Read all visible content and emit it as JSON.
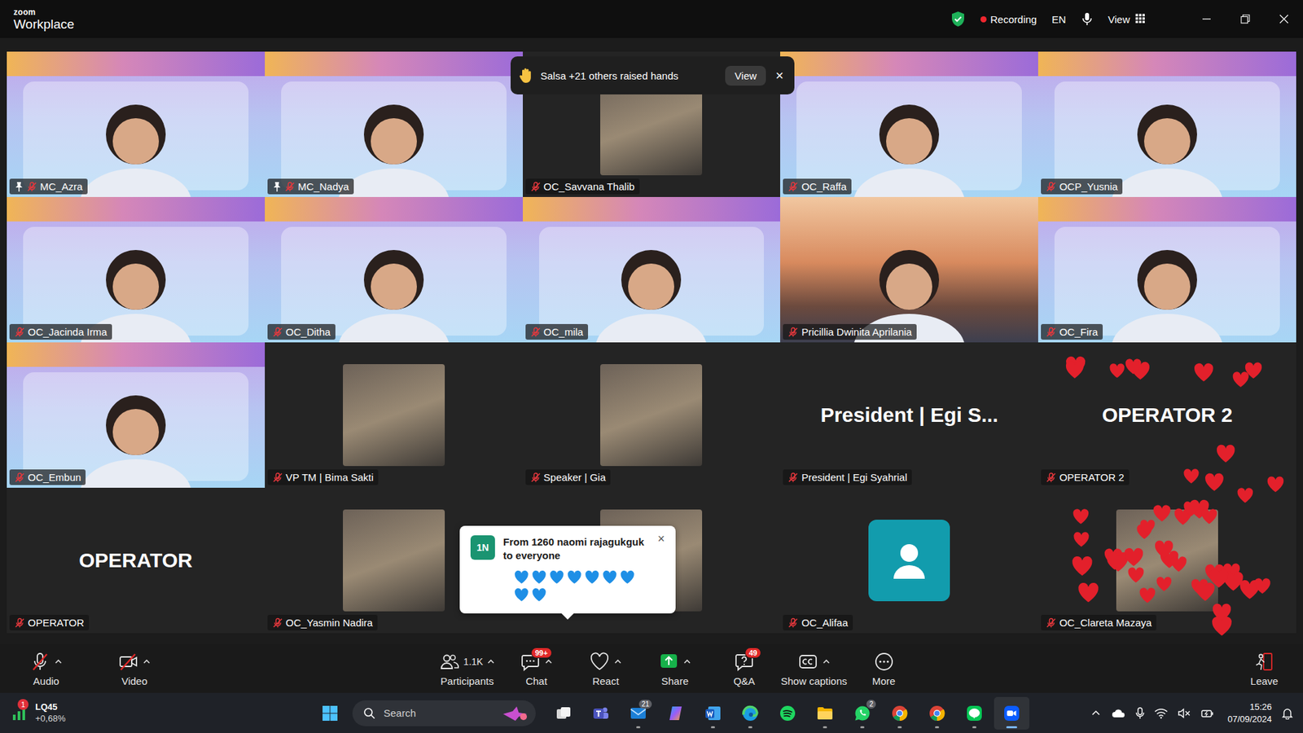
{
  "window": {
    "brand": "zoom",
    "product": "Workplace"
  },
  "status": {
    "secure": true,
    "recording": "Recording",
    "language": "EN",
    "view": "View"
  },
  "raised_hands": {
    "text": "Salsa +21 others raised hands",
    "action": "View",
    "close": "×"
  },
  "tiles": [
    {
      "name": "MC_Azra",
      "kind": "branded",
      "muted": true,
      "pinned": true,
      "speaking": true
    },
    {
      "name": "MC_Nadya",
      "kind": "branded",
      "muted": true,
      "pinned": true,
      "speaking": false
    },
    {
      "name": "OC_Savvana Thalib",
      "kind": "photo",
      "muted": true,
      "pinned": false,
      "speaking": false
    },
    {
      "name": "OC_Raffa",
      "kind": "branded",
      "muted": true,
      "pinned": false,
      "speaking": false
    },
    {
      "name": "OCP_Yusnia",
      "kind": "branded",
      "muted": true,
      "pinned": false,
      "speaking": false
    },
    {
      "name": "OC_Jacinda Irma",
      "kind": "branded",
      "muted": true,
      "pinned": false,
      "speaking": false
    },
    {
      "name": "OC_Ditha",
      "kind": "branded",
      "muted": true,
      "pinned": false,
      "speaking": false
    },
    {
      "name": "OC_mila",
      "kind": "branded",
      "muted": true,
      "pinned": false,
      "speaking": false
    },
    {
      "name": "Pricillia Dwinita Aprilania",
      "kind": "camera",
      "muted": true,
      "pinned": false,
      "speaking": false
    },
    {
      "name": "OC_Fira",
      "kind": "branded",
      "muted": true,
      "pinned": false,
      "speaking": false
    },
    {
      "name": "OC_Embun",
      "kind": "branded",
      "muted": true,
      "pinned": false,
      "speaking": false
    },
    {
      "name": "VP TM | Bima Sakti",
      "kind": "photo",
      "muted": true,
      "pinned": false,
      "speaking": false
    },
    {
      "name": "Speaker | Gia",
      "kind": "photo",
      "muted": true,
      "pinned": false,
      "speaking": false
    },
    {
      "name": "President | Egi Syahrial",
      "kind": "name",
      "display": "President | Egi S...",
      "muted": true,
      "pinned": false,
      "speaking": false
    },
    {
      "name": "OPERATOR 2",
      "kind": "name",
      "display": "OPERATOR 2",
      "muted": true,
      "pinned": false,
      "speaking": false
    },
    {
      "name": "OPERATOR",
      "kind": "name",
      "display": "OPERATOR",
      "muted": true,
      "pinned": false,
      "speaking": false
    },
    {
      "name": "OC_Yasmin Nadira",
      "kind": "photo",
      "muted": true,
      "pinned": false,
      "speaking": false
    },
    {
      "kind": "photo",
      "muted": true,
      "pinned": false,
      "speaking": false
    },
    {
      "name": "OC_Alifaa",
      "kind": "avatar",
      "muted": true,
      "pinned": false,
      "speaking": false
    },
    {
      "name": "OC_Clareta Mazaya",
      "kind": "photo",
      "muted": true,
      "pinned": false,
      "speaking": false
    }
  ],
  "reactions": {
    "hearts": 44
  },
  "chat_popup": {
    "badge": "1N",
    "title": "From 1260 naomi rajagukguk to everyone",
    "message": "💙💙💙💙💙💙💙💙💙",
    "close": "×"
  },
  "toolbar": {
    "left": [
      {
        "icon": "audio",
        "label": "Audio",
        "muted": true,
        "menu": true
      },
      {
        "icon": "video",
        "label": "Video",
        "muted": true,
        "menu": true
      }
    ],
    "center": [
      {
        "icon": "participants",
        "label": "Participants",
        "count": "1.1K",
        "menu": true
      },
      {
        "icon": "chat",
        "label": "Chat",
        "badge": "99+",
        "menu": true
      },
      {
        "icon": "react",
        "label": "React",
        "menu": true
      },
      {
        "icon": "share",
        "label": "Share",
        "menu": true
      },
      {
        "icon": "qa",
        "label": "Q&A",
        "badge": "49",
        "menu": false
      },
      {
        "icon": "captions",
        "label": "Show captions",
        "menu": true
      },
      {
        "icon": "more",
        "label": "More",
        "menu": false
      }
    ],
    "leave": "Leave"
  },
  "taskbar": {
    "widget": {
      "name": "LQ45",
      "change": "+0,68%",
      "badge": "1"
    },
    "search": "Search",
    "apps": [
      {
        "icon": "taskview",
        "running": false,
        "active": false
      },
      {
        "icon": "teams",
        "running": false,
        "active": false
      },
      {
        "icon": "mail",
        "badge": "21",
        "running": true,
        "active": false
      },
      {
        "icon": "copilot",
        "running": false,
        "active": false
      },
      {
        "icon": "word",
        "running": true,
        "active": false
      },
      {
        "icon": "edge",
        "running": true,
        "active": false
      },
      {
        "icon": "spotify",
        "running": false,
        "active": false
      },
      {
        "icon": "explorer",
        "running": true,
        "active": false
      },
      {
        "icon": "whatsapp",
        "badge": "2",
        "running": true,
        "active": false
      },
      {
        "icon": "chrome",
        "running": true,
        "active": false
      },
      {
        "icon": "chrome",
        "running": true,
        "active": false
      },
      {
        "icon": "line",
        "running": true,
        "active": false
      },
      {
        "icon": "zoom",
        "running": true,
        "active": true
      }
    ],
    "tray": {
      "volume_muted": true,
      "time": "15:26",
      "date": "07/09/2024"
    }
  }
}
